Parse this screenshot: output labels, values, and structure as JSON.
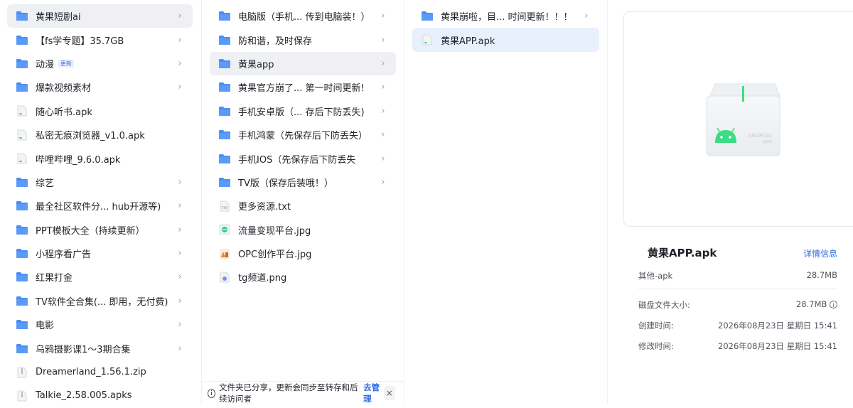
{
  "left_pane": {
    "items": [
      {
        "name": "黄果短剧ai",
        "type": "folder",
        "selected": true,
        "has_children": true
      },
      {
        "name": "【fs学专题】35.7GB",
        "type": "folder",
        "has_children": true
      },
      {
        "name": "动漫",
        "type": "folder",
        "badge": "更新",
        "has_children": true
      },
      {
        "name": "爆款视频素材",
        "type": "folder",
        "has_children": true
      },
      {
        "name": "随心听书.apk",
        "type": "apk"
      },
      {
        "name": "私密无痕浏览器_v1.0.apk",
        "type": "apk"
      },
      {
        "name": "哔哩哔哩_9.6.0.apk",
        "type": "apk"
      },
      {
        "name": "综艺",
        "type": "folder",
        "has_children": true
      },
      {
        "name": "最全社区软件分... hub开源等)",
        "type": "folder",
        "has_children": true
      },
      {
        "name": "PPT模板大全（持续更新）",
        "type": "folder",
        "has_children": true
      },
      {
        "name": "小程序看广告",
        "type": "folder",
        "has_children": true
      },
      {
        "name": "红果打金",
        "type": "folder",
        "has_children": true
      },
      {
        "name": "TV软件全合集(... 即用，无付费)",
        "type": "folder",
        "has_children": true
      },
      {
        "name": "电影",
        "type": "folder",
        "has_children": true
      },
      {
        "name": "乌鸦摄影课1～3期合集",
        "type": "folder",
        "has_children": true
      },
      {
        "name": "Dreamerland_1.56.1.zip",
        "type": "zip"
      },
      {
        "name": "Talkie_2.58.005.apks",
        "type": "zip"
      }
    ]
  },
  "middle_pane": {
    "items": [
      {
        "name": "电脑版（手机... 传到电脑装！）",
        "type": "folder",
        "has_children": true
      },
      {
        "name": "防和谐，及时保存",
        "type": "folder",
        "has_children": true
      },
      {
        "name": "黄果app",
        "type": "folder",
        "selected": true,
        "has_children": true
      },
      {
        "name": "黄果官方崩了... 第一时间更新!",
        "type": "folder",
        "has_children": true
      },
      {
        "name": "手机安卓版（... 存后下防丢失)",
        "type": "folder",
        "has_children": true
      },
      {
        "name": "手机鸿蒙（先保存后下防丢失）",
        "type": "folder",
        "has_children": true
      },
      {
        "name": "手机IOS（先保存后下防丢失",
        "type": "folder",
        "has_children": true
      },
      {
        "name": "TV版（保存后装哦！）",
        "type": "folder",
        "has_children": true
      },
      {
        "name": "更多资源.txt",
        "type": "txt"
      },
      {
        "name": "流量变现平台.jpg",
        "type": "jpg-green"
      },
      {
        "name": "OPC创作平台.jpg",
        "type": "jpg-orange"
      },
      {
        "name": "tg频道.png",
        "type": "png"
      }
    ],
    "share_notice": {
      "info_icon": "i",
      "text": "文件夹已分享，更新会同步至转存和后续访问者",
      "link": "去管理",
      "close": "×"
    }
  },
  "right_pane": {
    "items": [
      {
        "name": "黄果崩啦，目... 时间更新！！！",
        "type": "folder",
        "has_children": true
      },
      {
        "name": "黄果APP.apk",
        "type": "apk",
        "selected": true
      }
    ]
  },
  "details": {
    "preview_icon": "android-app-icon",
    "preview_watermark_line1": "ANDROID",
    "preview_watermark_line2": "APP",
    "file_name": "黄果APP.apk",
    "detail_link": "详情信息",
    "type_label": "其他-apk",
    "size": "28.7MB",
    "disk_size_label": "磁盘文件大小:",
    "disk_size_value": "28.7MB",
    "created_label": "创建时间:",
    "created_value": "2026年08月23日 星期日 15:41",
    "modified_label": "修改时间:",
    "modified_value": "2026年08月23日 星期日 15:41"
  },
  "colors": {
    "folder": "#4c8df5",
    "selected_gray": "#eef0f4",
    "selected_blue": "#e9f0fd",
    "link_blue": "#2f6ae8",
    "android_green": "#3ddc84"
  }
}
